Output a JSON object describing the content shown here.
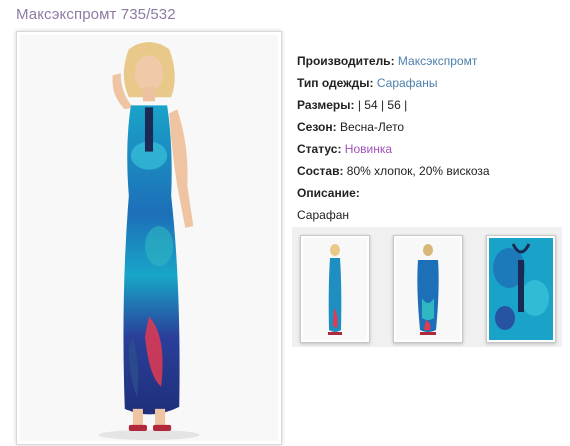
{
  "product": {
    "title": "Максэкспромт 735/532"
  },
  "details": {
    "manufacturer_label": "Производитель:",
    "manufacturer_value": "Максэкспромт",
    "type_label": "Тип одежды:",
    "type_value": "Сарафаны",
    "sizes_label": "Размеры:",
    "sizes_value": "| 54 | 56 |",
    "season_label": "Сезон:",
    "season_value": "Весна-Лето",
    "status_label": "Статус:",
    "status_value": "Новинка",
    "composition_label": "Состав:",
    "composition_value": "80% хлопок, 20% вискоза",
    "description_label": "Описание:",
    "description_value": "Сарафан"
  },
  "colors": {
    "title": "#8E7BA4",
    "link": "#4C7FAE",
    "status": "#A252B8",
    "dress_primary": "#1E8FC0",
    "dress_accent": "#E33A50"
  }
}
